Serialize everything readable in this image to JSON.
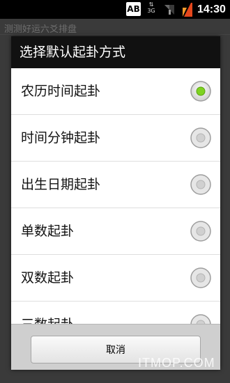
{
  "status_bar": {
    "input_indicator": "AB",
    "network": "3G",
    "time": "14:30"
  },
  "background_app": {
    "title": "测测好运六爻排盘"
  },
  "dialog": {
    "title": "选择默认起卦方式",
    "options": [
      {
        "label": "农历时间起卦",
        "selected": true
      },
      {
        "label": "时间分钟起卦",
        "selected": false
      },
      {
        "label": "出生日期起卦",
        "selected": false
      },
      {
        "label": "单数起卦",
        "selected": false
      },
      {
        "label": "双数起卦",
        "selected": false
      },
      {
        "label": "三数起卦",
        "selected": false
      }
    ],
    "cancel_label": "取消"
  },
  "watermark": "ITMOP.COM",
  "colors": {
    "selected_radio": "#7ed321",
    "dialog_header": "#111111",
    "list_background": "#ffffff"
  }
}
